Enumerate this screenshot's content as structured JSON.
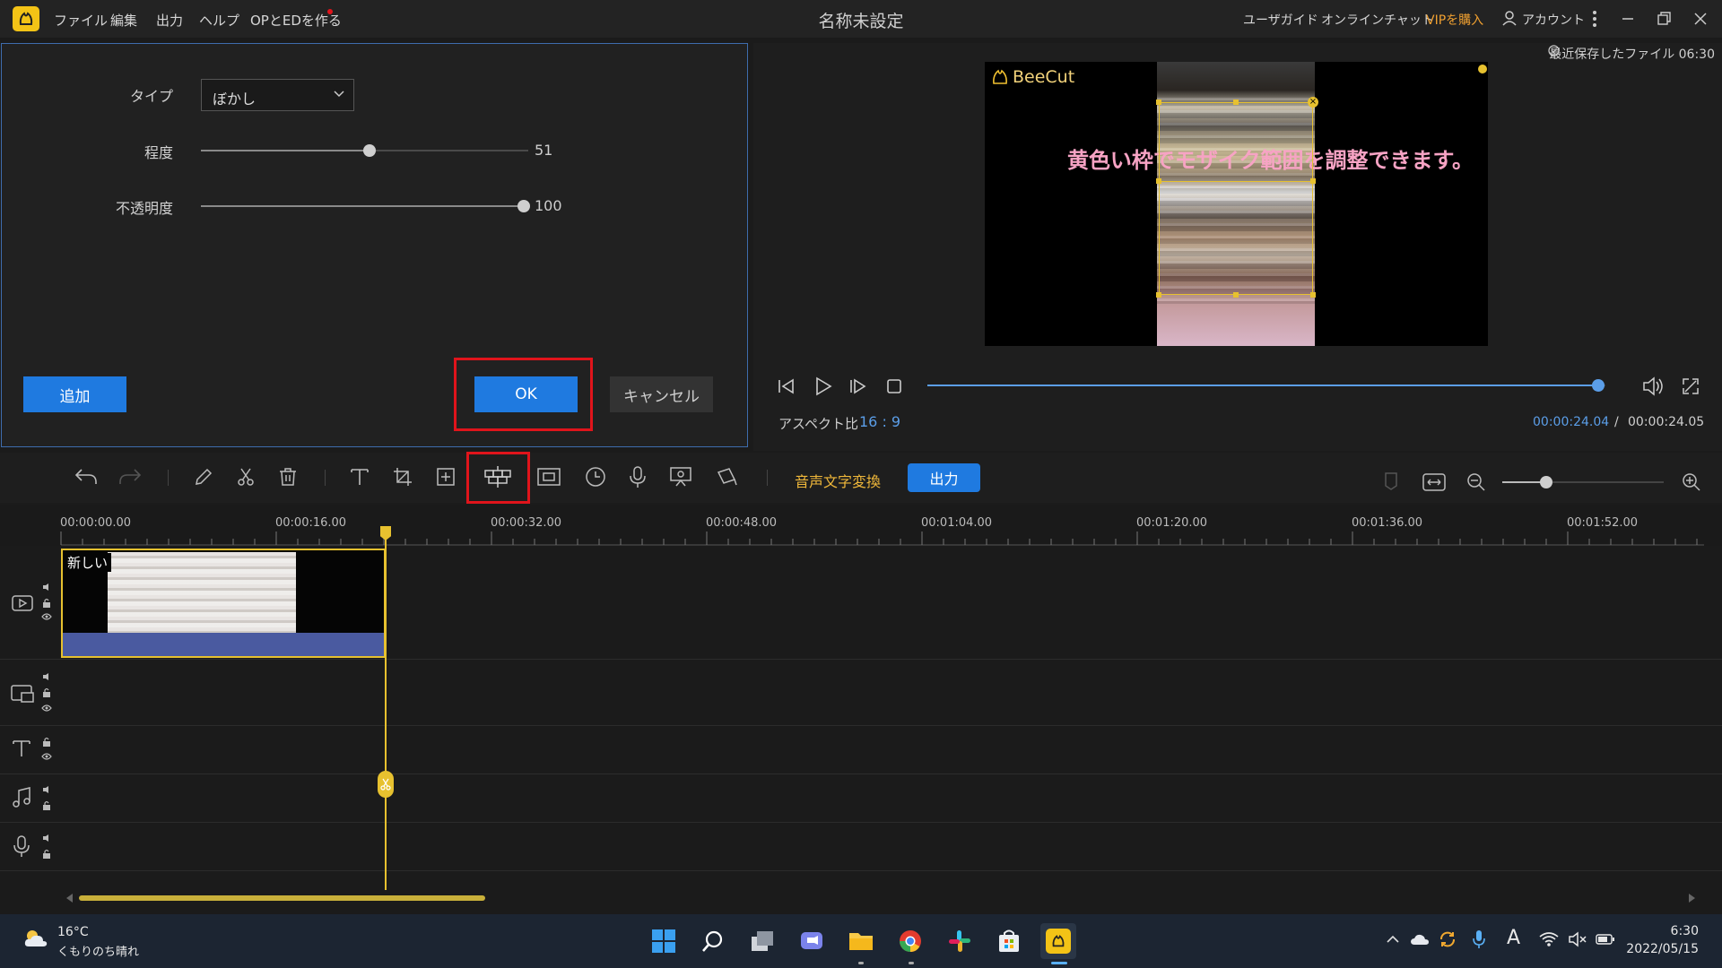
{
  "titlebar": {
    "menus": [
      "ファイル",
      "編集",
      "出力",
      "ヘルプ",
      "OPとEDを作る"
    ],
    "window_title": "名称未設定",
    "user_guide": "ユーザガイド",
    "online_chat": "オンラインチャット",
    "buy_vip": "VIPを購入",
    "account": "アカウント"
  },
  "settings": {
    "type_label": "タイプ",
    "type_value": "ぼかし",
    "degree_label": "程度",
    "degree_value": "51",
    "opacity_label": "不透明度",
    "opacity_value": "100",
    "add_button": "追加",
    "ok_button": "OK",
    "cancel_button": "キャンセル"
  },
  "preview": {
    "last_saved": "最近保存したファイル 06:30",
    "watermark": "BeeCut",
    "caption": "黄色い枠でモザイク範囲を調整できます。",
    "aspect_label": "アスペクト比",
    "aspect_value": "16 : 9",
    "current_time": "00:00:24.04",
    "separator": "/",
    "total_time": "00:00:24.05",
    "progress": 0.99
  },
  "toolbar": {
    "speech_to_text": "音声文字変換",
    "export": "出力",
    "zoom_level": 0.27
  },
  "timeline": {
    "ticks": [
      "00:00:00.00",
      "00:00:16.00",
      "00:00:32.00",
      "00:00:48.00",
      "00:01:04.00",
      "00:01:20.00",
      "00:01:36.00",
      "00:01:52.00"
    ],
    "clip_title": "新しい"
  },
  "taskbar": {
    "temperature": "16°C",
    "weather": "くもりのち晴れ",
    "time": "6:30",
    "date": "2022/05/15",
    "ime": "A"
  },
  "colors": {
    "accent_blue": "#1f7ae0",
    "highlight_red": "#e0141b",
    "timeline_yellow": "#e7c12f",
    "caption_pink": "#f7a3c4",
    "vip_orange": "#f0a030"
  }
}
